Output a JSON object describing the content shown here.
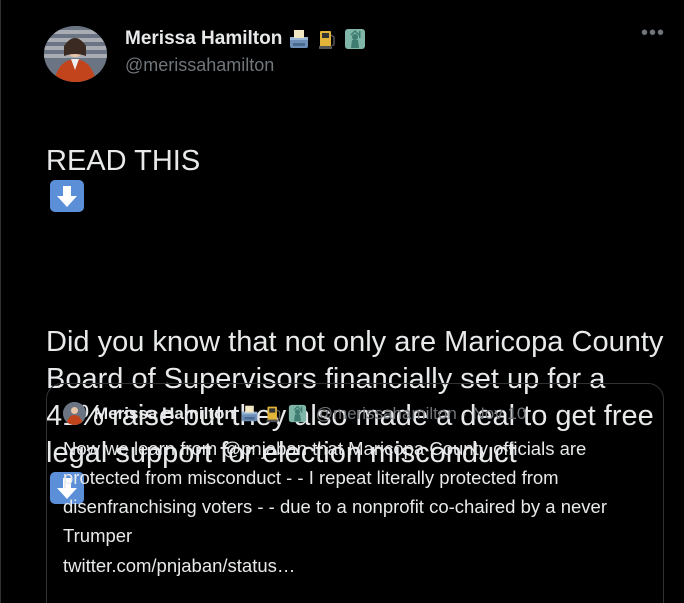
{
  "author": {
    "display_name": "Merissa Hamilton",
    "handle": "@merissahamilton",
    "badge_icons": [
      "ballot-box-icon",
      "fuel-pump-icon",
      "statue-of-liberty-icon"
    ]
  },
  "more_label": "•••",
  "tweet": {
    "line1": "READ THIS",
    "line2": "Did you know that not only are Maricopa County Board of Supervisors financially set up for a 41% raise but they also made a deal to get free legal support for election misconduct",
    "arrow_icon": "down-arrow-icon"
  },
  "quoted": {
    "display_name": "Merissa Hamilton",
    "handle": "@merissahamilton",
    "separator": "·",
    "date": "Nov 10",
    "text": "Now we learn from @pnjaban that Maricopa County officials are protected from misconduct - - I repeat literally protected from disenfranchising voters - - due to a nonprofit co-chaired by a never Trumper",
    "link": "twitter.com/pnjaban/status…"
  },
  "colors": {
    "background": "#000000",
    "text": "#e7e9ea",
    "muted": "#71767b",
    "border": "#2f3336",
    "arrow_blue": "#5b8fd8"
  }
}
